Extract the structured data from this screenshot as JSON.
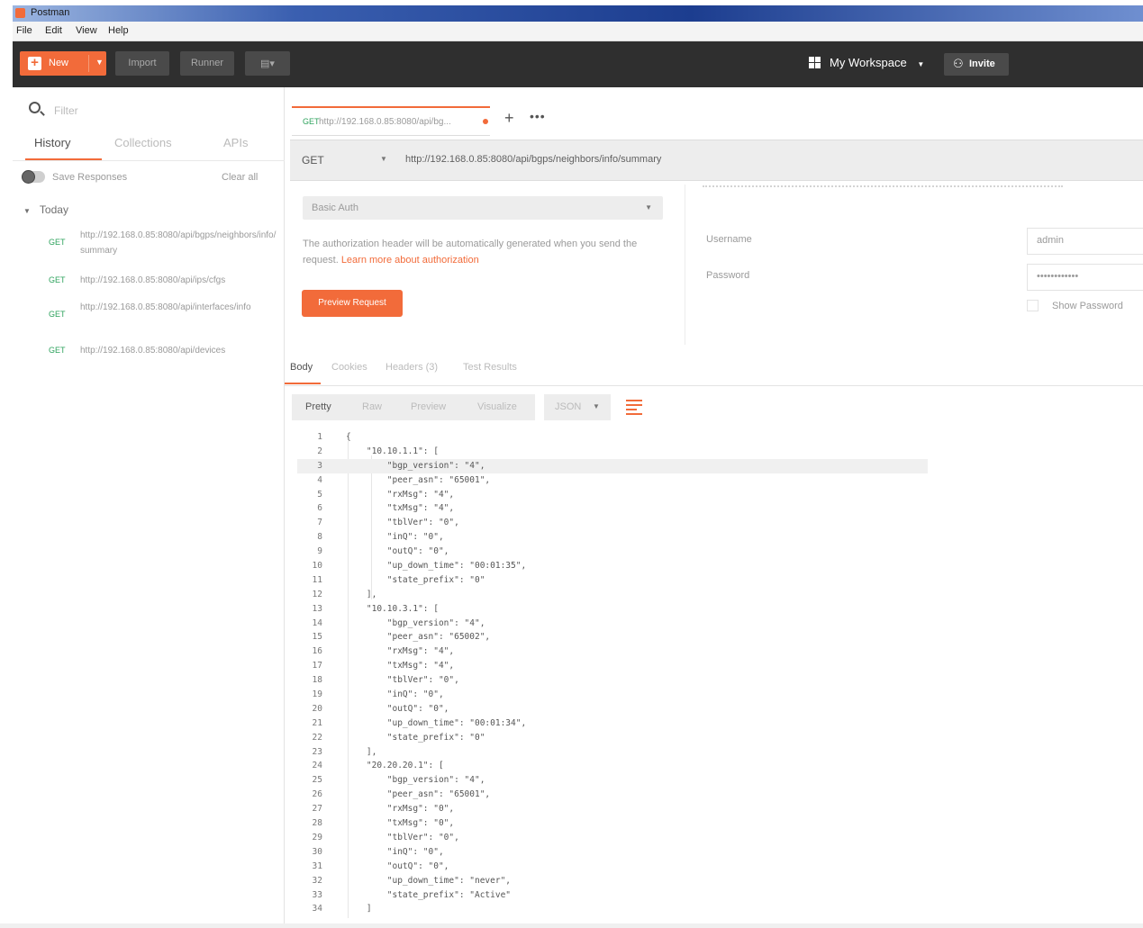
{
  "window": {
    "title": "Postman"
  },
  "menu": [
    "File",
    "Edit",
    "View",
    "Help"
  ],
  "toolbar": {
    "new_label": "New",
    "import_label": "Import",
    "runner_label": "Runner",
    "workspace_label": "My Workspace",
    "invite_label": "Invite"
  },
  "sidebar": {
    "filter_placeholder": "Filter",
    "tabs": [
      "History",
      "Collections",
      "APIs"
    ],
    "save_responses_label": "Save Responses",
    "clear_all_label": "Clear all",
    "group_label": "Today",
    "history": [
      {
        "method": "GET",
        "url": "http://192.168.0.85:8080/api/bgps/neighbors/info/summary"
      },
      {
        "method": "GET",
        "url": "http://192.168.0.85:8080/api/ips/cfgs"
      },
      {
        "method": "GET",
        "url": "http://192.168.0.85:8080/api/interfaces/info"
      },
      {
        "method": "GET",
        "url": "http://192.168.0.85:8080/api/devices"
      }
    ]
  },
  "request": {
    "tab": {
      "method": "GET",
      "url": "http://192.168.0.85:8080/api/bg..."
    },
    "method": "GET",
    "url": "http://192.168.0.85:8080/api/bgps/neighbors/info/summary"
  },
  "auth": {
    "type": "Basic Auth",
    "description": "The authorization header will be automatically generated when you send the request. ",
    "learn_more": "Learn more about authorization",
    "preview_label": "Preview Request",
    "username_label": "Username",
    "username_value": "admin",
    "password_label": "Password",
    "password_value": "••••••••••••",
    "show_password_label": "Show Password"
  },
  "response": {
    "tabs": [
      "Body",
      "Cookies",
      "Headers (3)",
      "Test Results"
    ],
    "views": [
      "Pretty",
      "Raw",
      "Preview",
      "Visualize"
    ],
    "format": "JSON",
    "lines": [
      "{",
      "    \"10.10.1.1\": [",
      "        \"bgp_version\": \"4\",",
      "        \"peer_asn\": \"65001\",",
      "        \"rxMsg\": \"4\",",
      "        \"txMsg\": \"4\",",
      "        \"tblVer\": \"0\",",
      "        \"inQ\": \"0\",",
      "        \"outQ\": \"0\",",
      "        \"up_down_time\": \"00:01:35\",",
      "        \"state_prefix\": \"0\"",
      "    ],",
      "    \"10.10.3.1\": [",
      "        \"bgp_version\": \"4\",",
      "        \"peer_asn\": \"65002\",",
      "        \"rxMsg\": \"4\",",
      "        \"txMsg\": \"4\",",
      "        \"tblVer\": \"0\",",
      "        \"inQ\": \"0\",",
      "        \"outQ\": \"0\",",
      "        \"up_down_time\": \"00:01:34\",",
      "        \"state_prefix\": \"0\"",
      "    ],",
      "    \"20.20.20.1\": [",
      "        \"bgp_version\": \"4\",",
      "        \"peer_asn\": \"65001\",",
      "        \"rxMsg\": \"0\",",
      "        \"txMsg\": \"0\",",
      "        \"tblVer\": \"0\",",
      "        \"inQ\": \"0\",",
      "        \"outQ\": \"0\",",
      "        \"up_down_time\": \"never\",",
      "        \"state_prefix\": \"Active\"",
      "    ]"
    ]
  },
  "colors": {
    "accent": "#f26b3a",
    "toolbar_bg": "#2f2f2f",
    "method_get": "#2ea35d"
  }
}
